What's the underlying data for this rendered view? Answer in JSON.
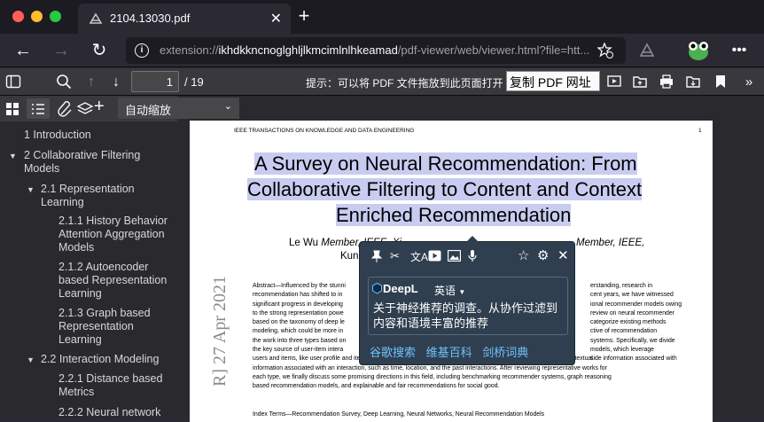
{
  "browser": {
    "tab_title": "2104.13030.pdf",
    "url_host": "extension://",
    "url_bold": "ikhdkkncnoglghljlkmcimlnlhkeamad",
    "url_rest": "/pdf-viewer/web/viewer.html?file=htt..."
  },
  "toolbar": {
    "page_number": "1",
    "page_count": "/ 19",
    "hint": "提示：可以将 PDF 文件拖放到此页面打开",
    "copy_url_label": "复制 PDF 网址"
  },
  "sidebar": {
    "zoom_selected": "自动缩放",
    "outline": [
      {
        "label": "1 Introduction"
      },
      {
        "label": "2 Collaborative Filtering Models"
      },
      {
        "label": "2.1 Representation Learning"
      },
      {
        "label": "2.1.1 History Behavior Attention Aggregation Models"
      },
      {
        "label": "2.1.2 Autoencoder based Representation Learning"
      },
      {
        "label": "2.1.3 Graph based Representation Learning"
      },
      {
        "label": "2.2 Interaction Modeling"
      },
      {
        "label": "2.2.1 Distance based Metrics"
      },
      {
        "label": "2.2.2 Neural network"
      }
    ]
  },
  "pdf": {
    "journal": "IEEE TRANSACTIONS ON KNOWLEDGE AND DATA ENGINEERING",
    "page_no": "1",
    "title_l1": "A Survey on Neural Recommendation: From",
    "title_l2": "Collaborative Filtering to Content and Context",
    "title_l3": "Enriched Recommendation",
    "authors_l1a": "Le Wu",
    "authors_l1b": "Member, IEEE, Xi",
    "authors_l1c": "Member, IEEE,",
    "authors_l2": "Kun",
    "arxiv": "R] 27 Apr 2021",
    "abstract_lines": [
      "Abstract—Influenced by the stunni",
      "recommendation has shifted to in",
      "significant progress in developing",
      "to the strong representation powe",
      "based on the taxonomy of deep le",
      "modeling, which could be more in",
      "the work into three types based on",
      "the key source of user-item intera",
      "users and items, like user profile and item knowledge graph; and 3) context enriched models, which account for the contextual",
      "information associated with an interaction, such as time, location, and the past interactions. After reviewing representative works for",
      "each type, we finally discuss some promising directions in this field, including benchmarking recommender systems, graph reasoning",
      "based recommendation models, and explainable and fair recommendations for social good."
    ],
    "abstract_right": [
      "erstanding, research in",
      "cent years, we have witnessed",
      "ional recommender models owing",
      "review on neural recommender",
      "categorize existing methods",
      "ctive of recommendation",
      "systems. Specifically, we divide",
      "models, which leverage",
      "side information associated with"
    ],
    "index_terms": "Index Terms—Recommendation Survey, Deep Learning, Neural Networks, Neural Recommendation Models"
  },
  "popup": {
    "source": "DeepL",
    "language": "英语",
    "translation": "关于神经推荐的调查。从协作过滤到内容和语境丰富的推荐",
    "links": [
      "谷歌搜索",
      "维基百科",
      "剑桥词典"
    ]
  },
  "colors": {
    "highlight": "#c8ccf0",
    "popup_bg": "#2f3f4f",
    "link": "#6ec1ff"
  }
}
